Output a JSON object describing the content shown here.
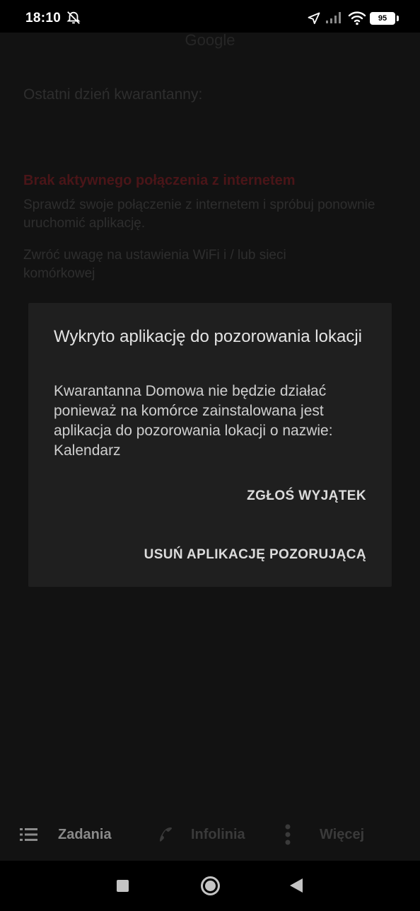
{
  "status_bar": {
    "time": "18:10",
    "battery": "95"
  },
  "background": {
    "app_title": "Google",
    "quarantine_label": "Ostatni dzień kwarantanny:",
    "error_title": "Brak aktywnego połączenia z internetem",
    "error_text": "Sprawdź swoje połączenie z internetem i spróbuj ponownie uruchomić aplikację.",
    "error_hint": "Zwróć uwagę na ustawienia WiFi i / lub sieci komórkowej"
  },
  "dialog": {
    "title": "Wykryto aplikację do pozorowania lokacji",
    "message": "Kwarantanna Domowa nie będzie działać ponieważ na komórce zainstalowana jest aplikacja do pozorowania lokacji o nazwie: Kalendarz",
    "button_exception": "ZGŁOŚ WYJĄTEK",
    "button_remove": "USUŃ APLIKACJĘ POZORUJĄCĄ"
  },
  "bottom_nav": {
    "tasks": {
      "label": "Zadania",
      "icon": "list-icon"
    },
    "infoline": {
      "label": "Infolinia",
      "icon": "phone-icon"
    },
    "more": {
      "label": "Więcej",
      "icon": "more-vertical-icon"
    }
  },
  "colors": {
    "background": "#121212",
    "dialog": "#1f1f1f",
    "error_red": "#4a1518"
  }
}
